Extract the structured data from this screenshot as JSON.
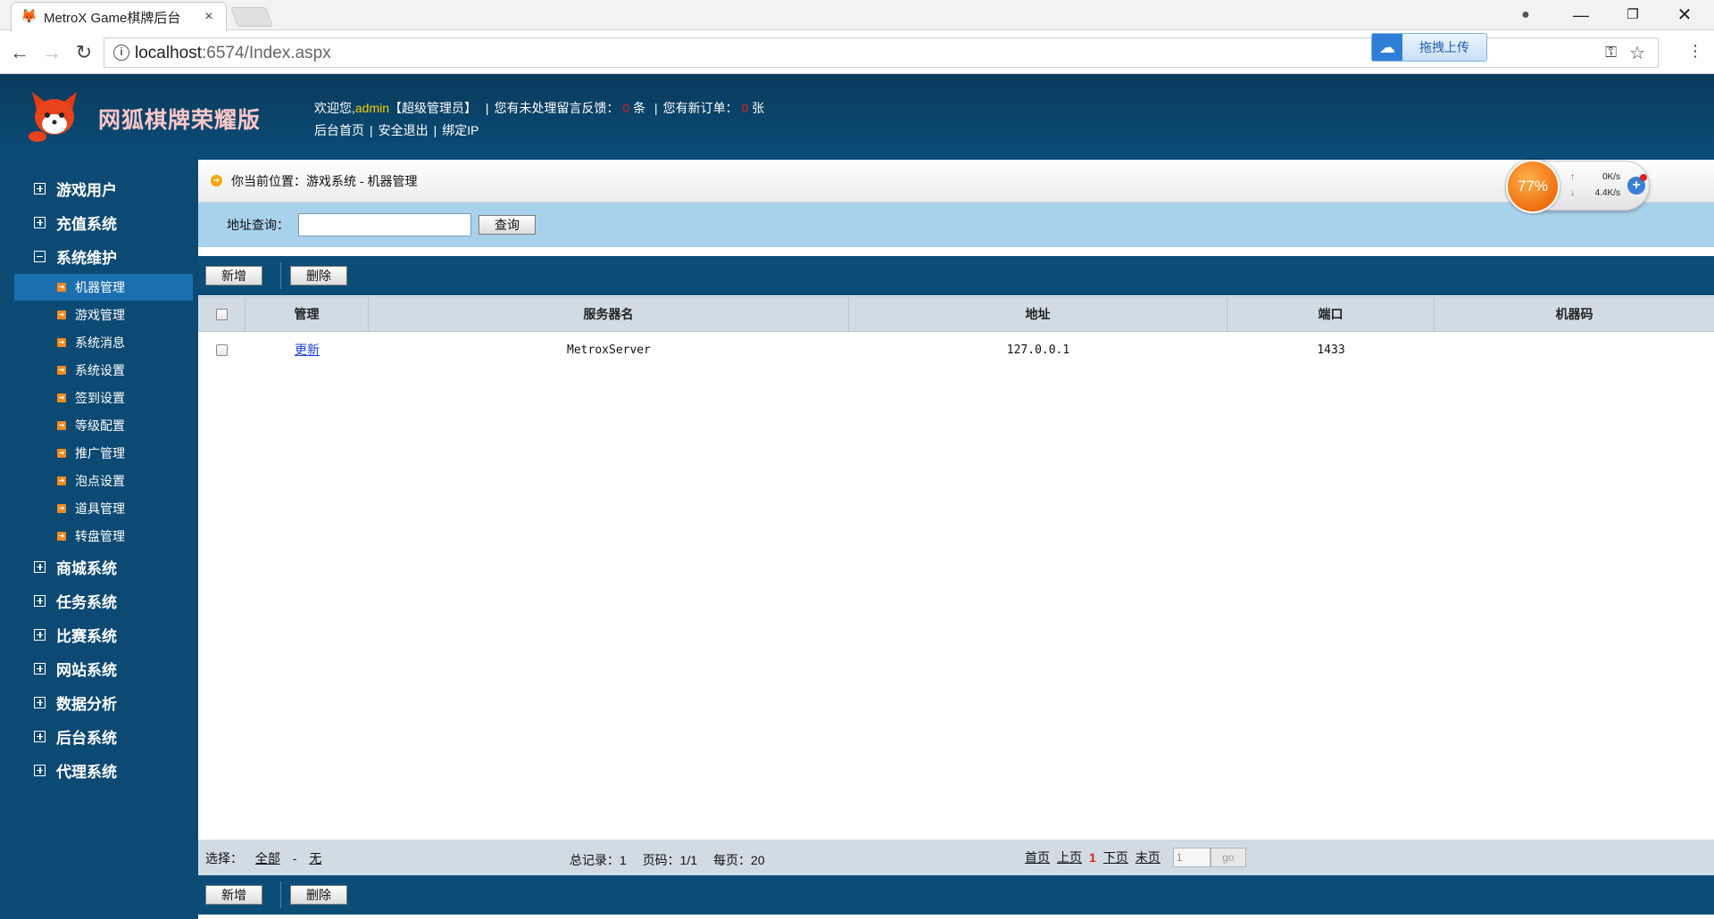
{
  "browser": {
    "tab_title": "MetroX Game棋牌后台",
    "tab_close": "×",
    "url_host": "localhost",
    "url_path": ":6574/Index.aspx",
    "upload_widget_label": "拖拽上传",
    "icons": {
      "favicon": "fox-favicon-icon",
      "account": "account-circle-icon",
      "back": "arrow-back-icon",
      "forward": "arrow-forward-icon",
      "reload": "reload-icon",
      "info": "info-icon",
      "key": "key-icon",
      "star": "star-icon",
      "menu": "more-vertical-icon"
    }
  },
  "header": {
    "logo_text": "网狐棋牌荣耀版",
    "welcome": "欢迎您,",
    "username": "admin",
    "role": "【超级管理员】",
    "feedback_prefix": "您有未处理留言反馈：",
    "feedback_count": "0",
    "feedback_unit": "条",
    "orders_prefix": "您有新订单：",
    "orders_count": "0",
    "orders_unit": "张",
    "links": {
      "home": "后台首页",
      "logout": "安全退出",
      "bind_ip": "绑定IP"
    }
  },
  "sidebar": {
    "groups_top": [
      {
        "label": "游戏用户"
      },
      {
        "label": "充值系统"
      },
      {
        "label": "系统维护"
      }
    ],
    "items": [
      {
        "label": "机器管理"
      },
      {
        "label": "游戏管理"
      },
      {
        "label": "系统消息"
      },
      {
        "label": "系统设置"
      },
      {
        "label": "签到设置"
      },
      {
        "label": "等级配置"
      },
      {
        "label": "推广管理"
      },
      {
        "label": "泡点设置"
      },
      {
        "label": "道具管理"
      },
      {
        "label": "转盘管理"
      }
    ],
    "groups_bottom": [
      {
        "label": "商城系统"
      },
      {
        "label": "任务系统"
      },
      {
        "label": "比赛系统"
      },
      {
        "label": "网站系统"
      },
      {
        "label": "数据分析"
      },
      {
        "label": "后台系统"
      },
      {
        "label": "代理系统"
      }
    ]
  },
  "content": {
    "breadcrumb": "你当前位置：游戏系统 - 机器管理",
    "search_label": "地址查询：",
    "search_value": "",
    "search_button": "查询",
    "add_button": "新增",
    "delete_button": "删除",
    "table": {
      "columns": [
        "管理",
        "服务器名",
        "地址",
        "端口",
        "机器码"
      ],
      "rows": [
        {
          "action": "更新",
          "server_name": "MetroxServer",
          "address": "127.0.0.1",
          "port": "1433",
          "machine_code": ""
        }
      ]
    },
    "pager": {
      "select_label": "选择：",
      "select_all": "全部",
      "select_dash": "-",
      "select_none": "无",
      "total": "总记录：1",
      "page": "页码：1/1",
      "per_page": "每页：20",
      "first": "首页",
      "prev": "上页",
      "current": "1",
      "next": "下页",
      "last": "末页",
      "jump_value": "1",
      "go": "go"
    }
  },
  "net_widget": {
    "percent": "77%",
    "up": "0K/s",
    "down": "4.4K/s",
    "plus": "+"
  },
  "colors": {
    "header_bg": "#0b4d77",
    "sidebar_active": "#1b6fae",
    "search_bar": "#a8d2ec",
    "count_red": "#e02020",
    "username_yellow": "#f5d000"
  }
}
